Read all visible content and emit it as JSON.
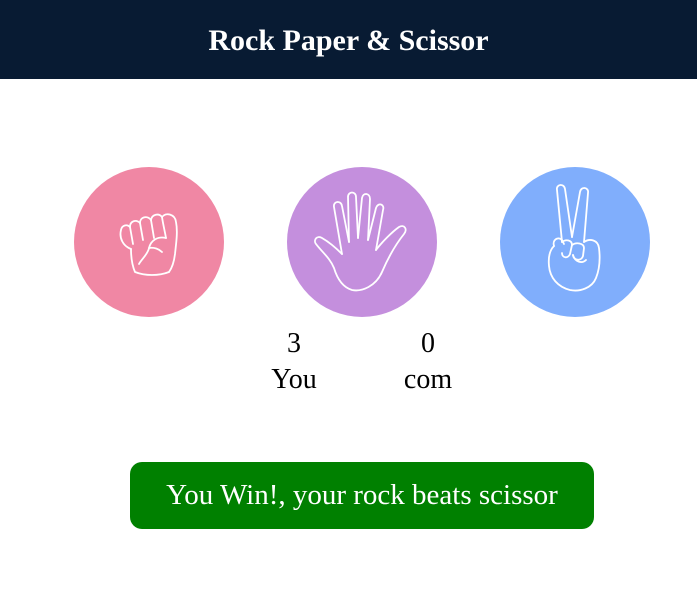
{
  "header": {
    "title": "Rock Paper & Scissor"
  },
  "choices": [
    {
      "id": "rock",
      "icon": "rock-fist-icon",
      "color": "#f087a4"
    },
    {
      "id": "paper",
      "icon": "paper-hand-icon",
      "color": "#c48fdd"
    },
    {
      "id": "scissor",
      "icon": "scissor-hand-icon",
      "color": "#80aefc"
    }
  ],
  "score": {
    "user": {
      "value": "3",
      "label": "You"
    },
    "computer": {
      "value": "0",
      "label": "com"
    }
  },
  "message": {
    "text": "You Win!, your rock beats scissor",
    "color": "#008000"
  },
  "theme": {
    "header_bg": "#081b33"
  }
}
